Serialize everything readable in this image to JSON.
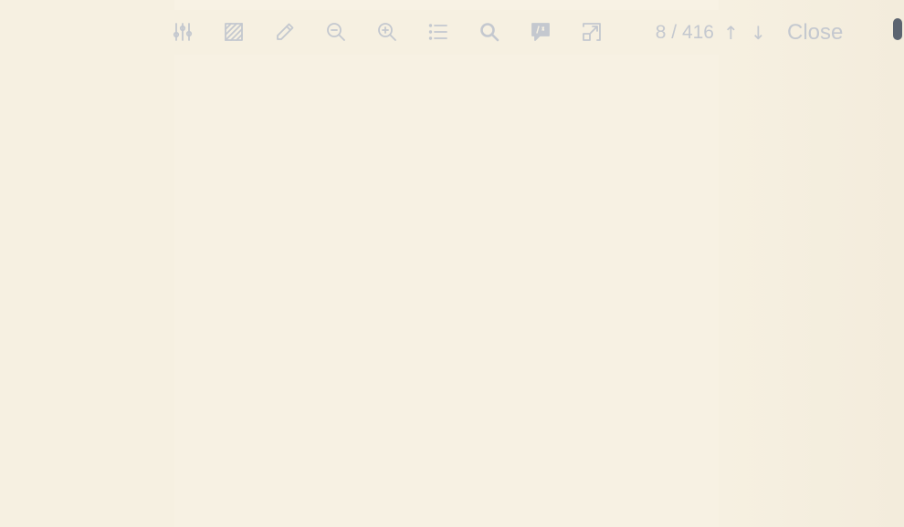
{
  "toolbar": {
    "icons": [
      "settings-sliders-icon",
      "hatch-pattern-icon",
      "pencil-icon",
      "zoom-out-icon",
      "zoom-in-icon",
      "list-icon",
      "search-icon",
      "comment-icon",
      "external-link-icon"
    ],
    "page_counter": "8 / 416",
    "prev_arrow": "↑",
    "next_arrow": "↓",
    "close_label": "Close"
  },
  "colors": {
    "background": "#f6f0e1",
    "page": "#f7f1e3",
    "icon": "#c4c8cf",
    "scrollbar_thumb": "#5c6470"
  }
}
